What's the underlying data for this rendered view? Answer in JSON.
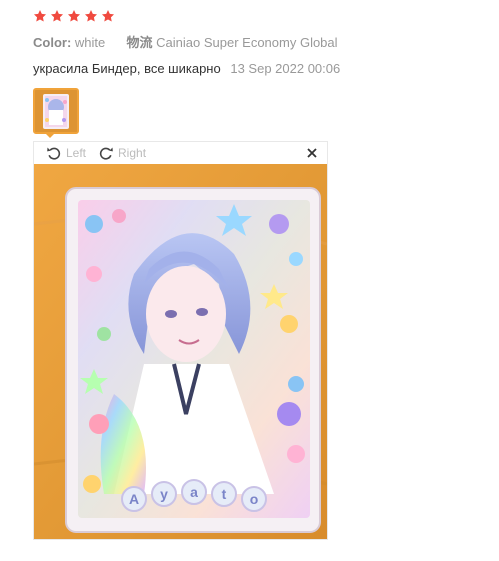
{
  "review": {
    "rating": 5,
    "star_color": "#f04a3f",
    "color_key": "Color:",
    "color_value": "white",
    "shipping_key": "物流",
    "shipping_value": "Cainiao Super Economy Global",
    "comment": "украсила Биндер, все шикарно",
    "date": "13 Sep 2022 00:06"
  },
  "viewer": {
    "left_label": "Left",
    "right_label": "Right",
    "rotate_left_icon": "rotate-left-icon",
    "rotate_right_icon": "rotate-right-icon",
    "close_icon": "close-icon",
    "photo_background": "#e39a36",
    "card_text": "Ayato"
  }
}
